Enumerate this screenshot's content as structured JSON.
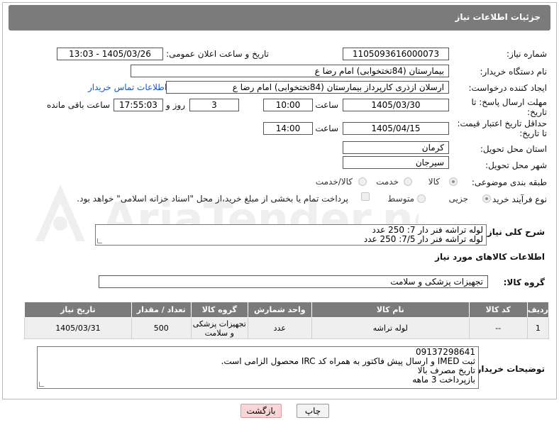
{
  "header": {
    "title": "جزئیات اطلاعات نیاز"
  },
  "watermark": {
    "text": "AriaTender.net"
  },
  "fields": {
    "need_number_label": "شماره نیاز:",
    "need_number": "1105093616000073",
    "announce_label": "تاریخ و ساعت اعلان عمومی:",
    "announce_value": "1405/03/26 - 13:03",
    "buyer_org_label": "نام دستگاه خریدار:",
    "buyer_org": "بیمارستان (84تختخوابی) امام رضا  ع",
    "creator_label": "ایجاد کننده درخواست:",
    "creator": "ارسلان ازذری کارپرداز بیمارستان (84تختخوابی) امام رضا  ع",
    "contact_link": "اطلاعات تماس خریدار",
    "deadline_label_1": "مهلت ارسال پاسخ: تا",
    "deadline_label_2": "تاریخ:",
    "deadline_date": "1405/03/30",
    "time_label": "ساعت",
    "deadline_time": "10:00",
    "days_value": "3",
    "days_label": "روز و",
    "remaining_time": "17:55:03",
    "remaining_label": "ساعت باقی مانده",
    "validity_label_1": "حداقل تاریخ اعتبار قیمت:",
    "validity_label_2": "تا تاریخ:",
    "validity_date": "1405/04/15",
    "validity_time": "14:00",
    "province_label": "استان محل تحویل:",
    "province": "کرمان",
    "city_label": "شهر محل تحویل:",
    "city": "سیرجان",
    "category_label": "طبقه بندی موضوعی:",
    "category_options": [
      "کالا",
      "خدمت",
      "کالا/خدمت"
    ],
    "category_selected": "کالا",
    "process_label": "نوع فرآیند خرید :",
    "process_options": [
      "جزیی",
      "متوسط"
    ],
    "process_selected": "جزیی",
    "payment_note": "پرداخت تمام یا بخشی از مبلغ خرید،از محل \"اسناد خزانه اسلامی\" خواهد بود."
  },
  "description": {
    "label": "شرح کلی نیاز:",
    "lines": [
      "لوله تراشه فنر دار 7: 250 عدد",
      "لوله تراشه فنر دار 7/5: 250 عدد"
    ]
  },
  "goods": {
    "section_title": "اطلاعات کالاهای مورد نیاز",
    "group_label": "گروه کالا:",
    "group_value": "تجهیزات پزشکی و سلامت",
    "columns": [
      "ردیف",
      "کد کالا",
      "نام کالا",
      "واحد شمارش",
      "گروه کالا",
      "تعداد / مقدار",
      "تاریخ نیاز"
    ],
    "rows": [
      [
        "1",
        "--",
        "لوله تراشه",
        "عدد",
        "تجهیزات پزشکی و سلامت",
        "500",
        "1405/03/31"
      ]
    ]
  },
  "buyer_notes": {
    "label": "توضیحات خریدار:",
    "lines": [
      "09137298641",
      "ثبت IMED و ارسال پیش فاکتور به همراه کد IRC محصول الزامی است.",
      "تاریخ مصرف بالا",
      "بازپرداخت 3 ماهه"
    ]
  },
  "buttons": {
    "print": "چاپ",
    "back": "بازگشت"
  },
  "colors": {
    "header_bg": "#7b7b7b",
    "link": "#1a55c9",
    "back_button": "#f8d6d6"
  }
}
